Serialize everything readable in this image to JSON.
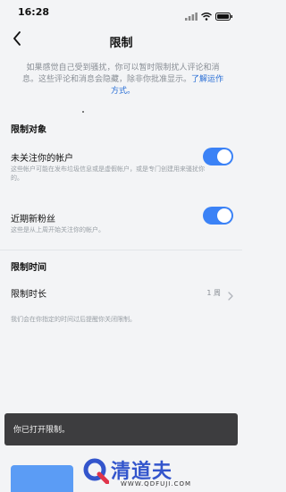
{
  "status_bar": {
    "time": "16:28"
  },
  "nav": {
    "title": "限制"
  },
  "intro": {
    "text": "如果感觉自己受到骚扰，你可以暂时限制扰人评论和消息。这些评论和消息会隐藏，除非你批准显示。",
    "link": "了解运作方式。"
  },
  "section_restrict_targets": {
    "title": "限制对象",
    "items": [
      {
        "title": "未关注你的帐户",
        "desc": "这些帐户可能在发布垃圾信息或是虚假帐户，或是专门创建用来骚扰你的。",
        "enabled": true
      },
      {
        "title": "近期新粉丝",
        "desc": "这些是从上周开始关注你的帐户。",
        "enabled": true
      }
    ]
  },
  "section_restrict_time": {
    "title": "限制时间",
    "row_label": "限制时长",
    "row_value": "1 周",
    "footnote": "我们会在你指定的时间过后提醒你关闭限制。"
  },
  "toast": {
    "text": "你已打开限制。"
  },
  "watermark": {
    "brand": "清道夫",
    "url": "WWW.QDFUJI.COM"
  },
  "colors": {
    "accent": "#3b82f6",
    "link": "#2a6fd6",
    "toast_bg": "#3d3d3f"
  }
}
